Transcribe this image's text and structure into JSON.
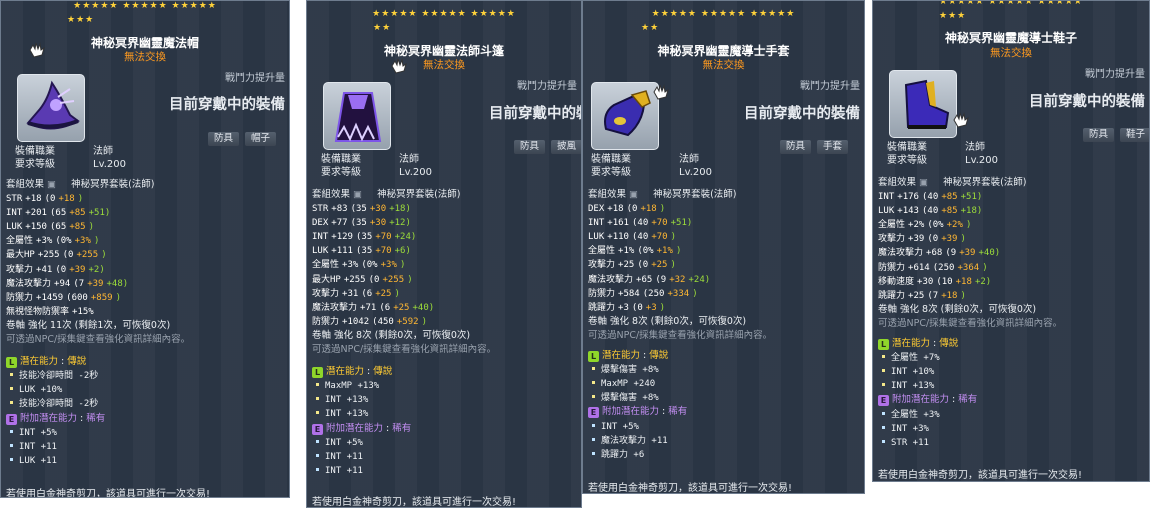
{
  "common": {
    "untradeable": "無法交換",
    "power_increase": "戰鬥力提升量",
    "currently_equipped": "目前穿戴中的裝備",
    "category": "防具",
    "job_label": "裝備職業",
    "job_value": "法師",
    "level_label": "要求等級",
    "level_value": "Lv.200",
    "set_label": "套組效果",
    "set_name": "神秘冥界套裝(法師)",
    "npc_note": "可透過NPC/採集鍵查看強化資訊詳細內容。",
    "potential_label": "潛在能力",
    "potential_tier": "傳說",
    "bonus_label": "附加潛在能力",
    "bonus_tier": "稀有",
    "footer": "若使用白金神奇剪刀，該道具可進行一次交易!"
  },
  "colors": {
    "panel": "#2a3544",
    "orange": "#ff9a1f",
    "green": "#9cdc3a",
    "blue": "#80c7f2",
    "gold": "#ffb733"
  },
  "cards": [
    {
      "stars_top": "★★★★★ ★★★★★ ★★★★★",
      "stars_bottom": "★★★",
      "name": "神秘冥界幽靈魔法帽",
      "subtype": "帽子",
      "icon": "hat-icon",
      "stats": [
        [
          "STR",
          "+18",
          "(0",
          "+18",
          ")"
        ],
        [
          "INT",
          "+201",
          "(65",
          "+85",
          "+51)"
        ],
        [
          "LUK",
          "+150",
          "(65",
          "+85",
          ")"
        ],
        [
          "全屬性",
          "+3%",
          "(0%",
          "+3%",
          ")"
        ],
        [
          "最大HP",
          "+255",
          "(0",
          "+255",
          ")"
        ],
        [
          "攻擊力",
          "+41",
          "(0",
          "+39",
          "+2)"
        ],
        [
          "魔法攻擊力",
          "+94",
          "(7",
          "+39",
          "+48)"
        ],
        [
          "防禦力",
          "+1459",
          "(600",
          "+859",
          ")"
        ],
        [
          "無視怪物防禦率",
          "+15%",
          "",
          "",
          ""
        ]
      ],
      "scroll": "卷軸 強化 11次 (剩餘1次，可恢復0次)",
      "potential": [
        "技能冷卻時間 -2秒",
        "LUK +10%",
        "技能冷卻時間 -2秒"
      ],
      "bonus": [
        "INT +5%",
        "INT +11",
        "LUK +11"
      ]
    },
    {
      "stars_top": "★★★★★ ★★★★★ ★★★★★",
      "stars_bottom": "★★",
      "name": "神秘冥界幽靈法師斗篷",
      "subtype": "披風",
      "icon": "cape-icon",
      "stats": [
        [
          "STR",
          "+83",
          "(35",
          "+30",
          "+18)"
        ],
        [
          "DEX",
          "+77",
          "(35",
          "+30",
          "+12)"
        ],
        [
          "INT",
          "+129",
          "(35",
          "+70",
          "+24)"
        ],
        [
          "LUK",
          "+111",
          "(35",
          "+70",
          "+6)"
        ],
        [
          "全屬性",
          "+3%",
          "(0%",
          "+3%",
          ")"
        ],
        [
          "最大HP",
          "+255",
          "(0",
          "+255",
          ")"
        ],
        [
          "攻擊力",
          "+31",
          "(6",
          "+25",
          ")"
        ],
        [
          "魔法攻擊力",
          "+71",
          "(6",
          "+25",
          "+40)"
        ],
        [
          "防禦力",
          "+1042",
          "(450",
          "+592",
          ")"
        ]
      ],
      "scroll": "卷軸 強化 8次 (剩餘0次，可恢復0次)",
      "potential": [
        "MaxMP +13%",
        "INT +13%",
        "INT +13%"
      ],
      "bonus": [
        "INT +5%",
        "INT +11",
        "INT +11"
      ]
    },
    {
      "stars_top": "★★★★★ ★★★★★ ★★★★★",
      "stars_bottom": "★★",
      "name": "神秘冥界幽靈魔導士手套",
      "subtype": "手套",
      "icon": "glove-icon",
      "stats": [
        [
          "DEX",
          "+18",
          "(0",
          "+18",
          ")"
        ],
        [
          "INT",
          "+161",
          "(40",
          "+70",
          "+51)"
        ],
        [
          "LUK",
          "+110",
          "(40",
          "+70",
          ")"
        ],
        [
          "全屬性",
          "+1%",
          "(0%",
          "+1%",
          ")"
        ],
        [
          "攻擊力",
          "+25",
          "(0",
          "+25",
          ")"
        ],
        [
          "魔法攻擊力",
          "+65",
          "(9",
          "+32",
          "+24)"
        ],
        [
          "防禦力",
          "+584",
          "(250",
          "+334",
          ")"
        ],
        [
          "跳躍力",
          "+3",
          "(0",
          "+3",
          ")"
        ]
      ],
      "scroll": "卷軸 強化 8次 (剩餘0次，可恢復0次)",
      "potential": [
        "爆擊傷害 +8%",
        "MaxMP +240",
        "爆擊傷害 +8%"
      ],
      "bonus": [
        "INT +5%",
        "魔法攻擊力 +11",
        "跳躍力 +6"
      ]
    },
    {
      "stars_top": "★★★★★ ★★★★★ ★★★★★",
      "stars_bottom": "★★★",
      "name": "神秘冥界幽靈魔導士鞋子",
      "subtype": "鞋子",
      "icon": "shoe-icon",
      "stats": [
        [
          "INT",
          "+176",
          "(40",
          "+85",
          "+51)"
        ],
        [
          "LUK",
          "+143",
          "(40",
          "+85",
          "+18)"
        ],
        [
          "全屬性",
          "+2%",
          "(0%",
          "+2%",
          ")"
        ],
        [
          "攻擊力",
          "+39",
          "(0",
          "+39",
          ")"
        ],
        [
          "魔法攻擊力",
          "+68",
          "(9",
          "+39",
          "+40)"
        ],
        [
          "防禦力",
          "+614",
          "(250",
          "+364",
          ")"
        ],
        [
          "移動速度",
          "+30",
          "(10",
          "+18",
          "+2)"
        ],
        [
          "跳躍力",
          "+25",
          "(7",
          "+18",
          ")"
        ]
      ],
      "scroll": "卷軸 強化 8次 (剩餘0次，可恢復0次)",
      "potential": [
        "全屬性 +7%",
        "INT +10%",
        "INT +13%"
      ],
      "bonus": [
        "全屬性 +3%",
        "INT +3%",
        "STR +11"
      ]
    }
  ]
}
